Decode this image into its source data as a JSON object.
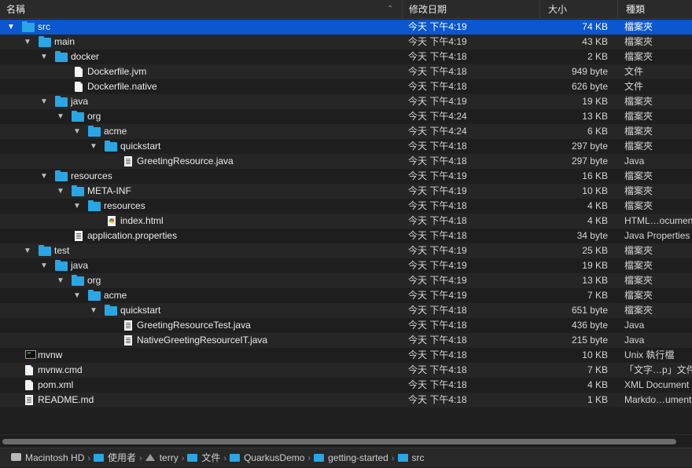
{
  "header": {
    "name": "名稱",
    "date": "修改日期",
    "size": "大小",
    "kind": "種類",
    "sort_icon": "chevron-up-icon"
  },
  "rows": [
    {
      "name": "src",
      "depth": 0,
      "icon": "folder",
      "expanded": true,
      "date": "今天 下午4:19",
      "size": "74 KB",
      "kind": "檔案夾",
      "selected": true
    },
    {
      "name": "main",
      "depth": 1,
      "icon": "folder",
      "expanded": true,
      "date": "今天 下午4:19",
      "size": "43 KB",
      "kind": "檔案夾"
    },
    {
      "name": "docker",
      "depth": 2,
      "icon": "folder",
      "expanded": true,
      "date": "今天 下午4:18",
      "size": "2 KB",
      "kind": "檔案夾"
    },
    {
      "name": "Dockerfile.jvm",
      "depth": 3,
      "icon": "file",
      "date": "今天 下午4:18",
      "size": "949 byte",
      "kind": "文件"
    },
    {
      "name": "Dockerfile.native",
      "depth": 3,
      "icon": "file",
      "date": "今天 下午4:18",
      "size": "626 byte",
      "kind": "文件"
    },
    {
      "name": "java",
      "depth": 2,
      "icon": "folder",
      "expanded": true,
      "date": "今天 下午4:19",
      "size": "19 KB",
      "kind": "檔案夾"
    },
    {
      "name": "org",
      "depth": 3,
      "icon": "folder",
      "expanded": true,
      "date": "今天 下午4:24",
      "size": "13 KB",
      "kind": "檔案夾"
    },
    {
      "name": "acme",
      "depth": 4,
      "icon": "folder",
      "expanded": true,
      "date": "今天 下午4:24",
      "size": "6 KB",
      "kind": "檔案夾"
    },
    {
      "name": "quickstart",
      "depth": 5,
      "icon": "folder",
      "expanded": true,
      "date": "今天 下午4:18",
      "size": "297 byte",
      "kind": "檔案夾"
    },
    {
      "name": "GreetingResource.java",
      "depth": 6,
      "icon": "text-file",
      "date": "今天 下午4:18",
      "size": "297 byte",
      "kind": "Java"
    },
    {
      "name": "resources",
      "depth": 2,
      "icon": "folder",
      "expanded": true,
      "date": "今天 下午4:19",
      "size": "16 KB",
      "kind": "檔案夾"
    },
    {
      "name": "META-INF",
      "depth": 3,
      "icon": "folder",
      "expanded": true,
      "date": "今天 下午4:19",
      "size": "10 KB",
      "kind": "檔案夾"
    },
    {
      "name": "resources",
      "depth": 4,
      "icon": "folder",
      "expanded": true,
      "date": "今天 下午4:18",
      "size": "4 KB",
      "kind": "檔案夾"
    },
    {
      "name": "index.html",
      "depth": 5,
      "icon": "html-file",
      "date": "今天 下午4:18",
      "size": "4 KB",
      "kind": "HTML…ocumen"
    },
    {
      "name": "application.properties",
      "depth": 3,
      "icon": "text-file",
      "date": "今天 下午4:18",
      "size": "34 byte",
      "kind": "Java Properties"
    },
    {
      "name": "test",
      "depth": 1,
      "icon": "folder",
      "expanded": true,
      "date": "今天 下午4:19",
      "size": "25 KB",
      "kind": "檔案夾"
    },
    {
      "name": "java",
      "depth": 2,
      "icon": "folder",
      "expanded": true,
      "date": "今天 下午4:19",
      "size": "19 KB",
      "kind": "檔案夾"
    },
    {
      "name": "org",
      "depth": 3,
      "icon": "folder",
      "expanded": true,
      "date": "今天 下午4:19",
      "size": "13 KB",
      "kind": "檔案夾"
    },
    {
      "name": "acme",
      "depth": 4,
      "icon": "folder",
      "expanded": true,
      "date": "今天 下午4:19",
      "size": "7 KB",
      "kind": "檔案夾"
    },
    {
      "name": "quickstart",
      "depth": 5,
      "icon": "folder",
      "expanded": true,
      "date": "今天 下午4:18",
      "size": "651 byte",
      "kind": "檔案夾"
    },
    {
      "name": "GreetingResourceTest.java",
      "depth": 6,
      "icon": "text-file",
      "date": "今天 下午4:18",
      "size": "436 byte",
      "kind": "Java"
    },
    {
      "name": "NativeGreetingResourceIT.java",
      "depth": 6,
      "icon": "text-file",
      "date": "今天 下午4:18",
      "size": "215 byte",
      "kind": "Java"
    },
    {
      "name": "mvnw",
      "depth": 0,
      "icon": "terminal",
      "date": "今天 下午4:18",
      "size": "10 KB",
      "kind": "Unix 執行檔"
    },
    {
      "name": "mvnw.cmd",
      "depth": 0,
      "icon": "file",
      "date": "今天 下午4:18",
      "size": "7 KB",
      "kind": "「文字…p」文件"
    },
    {
      "name": "pom.xml",
      "depth": 0,
      "icon": "file",
      "date": "今天 下午4:18",
      "size": "4 KB",
      "kind": "XML Document"
    },
    {
      "name": "README.md",
      "depth": 0,
      "icon": "text-file",
      "date": "今天 下午4:18",
      "size": "1 KB",
      "kind": "Markdo…ument"
    }
  ],
  "pathbar": [
    {
      "label": "Macintosh HD",
      "icon": "hard-drive-icon"
    },
    {
      "label": "使用者",
      "icon": "folder-icon"
    },
    {
      "label": "terry",
      "icon": "home-icon"
    },
    {
      "label": "文件",
      "icon": "folder-icon"
    },
    {
      "label": "QuarkusDemo",
      "icon": "folder-icon"
    },
    {
      "label": "getting-started",
      "icon": "folder-icon"
    },
    {
      "label": "src",
      "icon": "folder-icon"
    }
  ],
  "colors": {
    "selection": "#0a57cf",
    "folder": "#29a6e3",
    "background": "#1e1e1e"
  }
}
